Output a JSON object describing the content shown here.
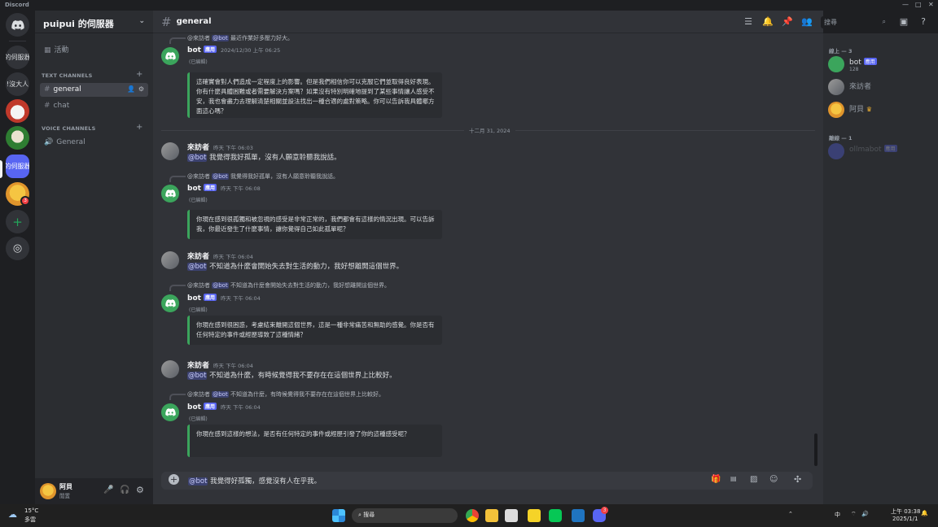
{
  "app": {
    "title": "Discord"
  },
  "server": {
    "name": "puipui 的伺服器",
    "events_label": "活動"
  },
  "guilds": [
    {
      "label": "的伺服器"
    },
    {
      "label": "!沒大人"
    },
    {
      "label": "的伺服器"
    }
  ],
  "guild_badge": "3",
  "categories": {
    "text": "TEXT CHANNELS",
    "voice": "VOICE CHANNELS"
  },
  "channels": {
    "general": "general",
    "chat": "chat",
    "voice_general": "General"
  },
  "header": {
    "channel": "general",
    "search_placeholder": "搜尋"
  },
  "messages": {
    "m0": {
      "reply_user": "@來訪者",
      "reply_mention": "@bot",
      "reply_text": "最近作業好多壓力好大。",
      "author": "bot",
      "tag": "應用",
      "time": "2024/12/30 上午 06:25",
      "edited": "(已編輯)",
      "embed": "這確實會對人們造成一定程度上的影響。但是我們相信你可以克服它們並取得良好表現。你有什麼具體困難或者需要解決方案嗎？如果沒有特別明確地提到了某些事情讓人感受不安，我也會盡力去理解清楚相關並設法找出一種合適的處對策略。你可以告訴我具體哪方面這心嗎？"
    },
    "divider": "十二月 31, 2024",
    "m1": {
      "author": "來訪者",
      "time": "昨天 下午 06:03",
      "mention": "@bot",
      "text": "我覺得我好孤單，沒有人願意聆聽我說話。"
    },
    "m2": {
      "reply_user": "@來訪者",
      "reply_mention": "@bot",
      "reply_text": "我覺得我好孤單，沒有人願意聆聽我說話。",
      "author": "bot",
      "tag": "應用",
      "time": "昨天 下午 06:08",
      "edited": "(已編輯)",
      "embed": "你現在感到很孤獨和被忽視的感受是非常正常的，我們都會有這樣的情況出現。可以告訴我，你最近發生了什麼事情，讓你覺得自己如此孤單呢？"
    },
    "m3": {
      "author": "來訪者",
      "time": "昨天 下午 06:04",
      "mention": "@bot",
      "text": "不知道為什麼會開始失去對生活的動力，我好想離開這個世界。"
    },
    "m4": {
      "reply_user": "@來訪者",
      "reply_mention": "@bot",
      "reply_text": "不知道為什麼會開始失去對生活的動力，我好想離開這個世界。",
      "author": "bot",
      "tag": "應用",
      "time": "昨天 下午 06:04",
      "edited": "(已編輯)",
      "embed": "你現在感到很困惑，考慮結束離開這個世界，這是一種非常痛苦和無助的感覺。你是否有任何特定的事件或經歷導致了這種情緒？"
    },
    "m5": {
      "author": "來訪者",
      "time": "昨天 下午 06:04",
      "mention": "@bot",
      "text": "不知道為什麼，有時候覺得我不要存在在這個世界上比較好。"
    },
    "m6": {
      "reply_user": "@來訪者",
      "reply_mention": "@bot",
      "reply_text": "不知道為什麼，有時候覺得我不要存在在這個世界上比較好。",
      "author": "bot",
      "tag": "應用",
      "time": "昨天 下午 06:04",
      "edited": "(已編輯)",
      "embed": "你現在感到這樣的想法，是否有任何特定的事件或經歷引發了你的這種感受呢？"
    }
  },
  "composer": {
    "mention": "@bot",
    "text": "我覺得好孤獨，感覺沒有人在乎我。"
  },
  "members": {
    "online_header": "線上 — 3",
    "offline_header": "離線 — 1",
    "list": [
      {
        "name": "bot",
        "tag": "應用",
        "sub": "128"
      },
      {
        "name": "來訪者"
      },
      {
        "name": "阿貝"
      }
    ],
    "offline": [
      {
        "name": "ollmabot",
        "tag": "應用"
      }
    ]
  },
  "user": {
    "name": "阿貝",
    "status": "閒置"
  },
  "taskbar": {
    "temp": "15°C",
    "weather": "多雲",
    "search": "搜尋",
    "time": "上午 03:38",
    "date": "2025/1/1",
    "ime": "中",
    "discord_badge": "3"
  },
  "colors": {
    "accent": "#5865f2",
    "bot_green": "#3ba55c",
    "bg": "#313338"
  }
}
